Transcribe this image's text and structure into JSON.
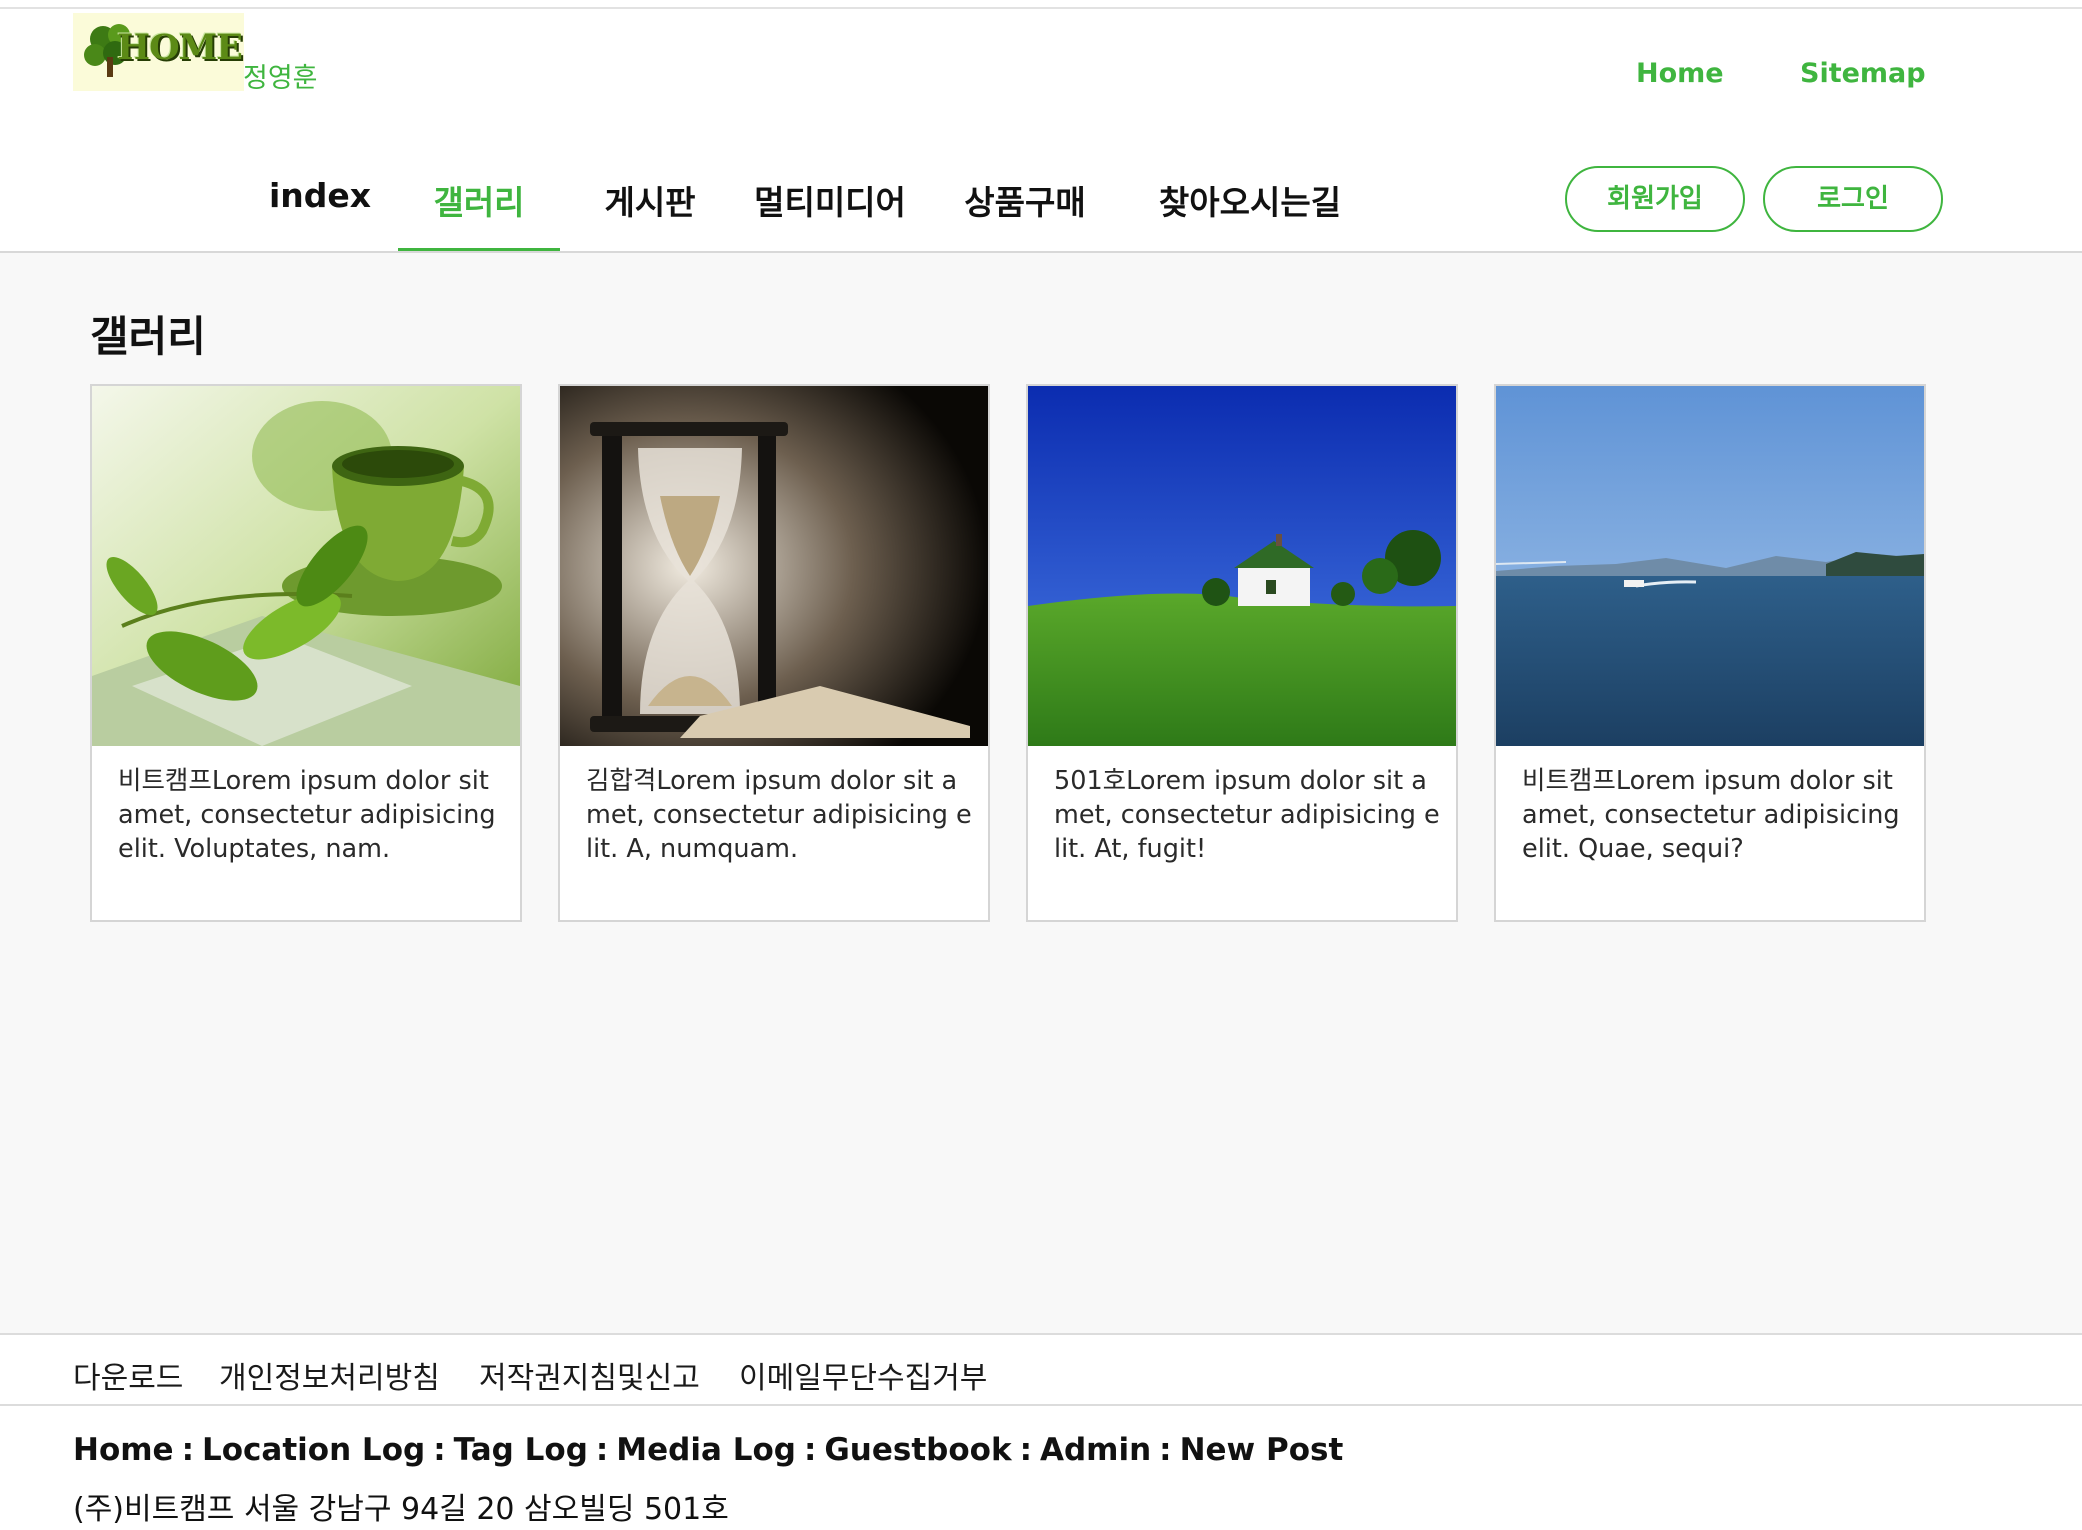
{
  "header": {
    "logo_text": "HOME",
    "owner_name": "정영훈",
    "top_links": [
      "Home",
      "Sitemap"
    ]
  },
  "nav": {
    "items": [
      "index",
      "갤러리",
      "게시판",
      "멀티미디어",
      "상품구매",
      "찾아오시는길"
    ],
    "active_index": 1,
    "signup_label": "회원가입",
    "login_label": "로그인"
  },
  "colors": {
    "accent": "#3fb53f",
    "main_bg": "#f8f8f8",
    "logo_bg": "#fbfbd9"
  },
  "gallery": {
    "title": "갤러리",
    "cards": [
      {
        "image": "green-teacup-with-leaves",
        "caption": "비트캠프Lorem ipsum dolor sit amet, consectetur adipisicing elit. Voluptates, nam."
      },
      {
        "image": "hourglass-with-sand",
        "caption": "김합격Lorem ipsum dolor sit amet, consectetur adipisicing elit. A, numquam."
      },
      {
        "image": "white-house-on-green-hill",
        "caption": "501호Lorem ipsum dolor sit amet, consectetur adipisicing elit. At, fugit!"
      },
      {
        "image": "sea-with-boat-and-bridge",
        "caption": "비트캠프Lorem ipsum dolor sit amet, consectetur adipisicing elit. Quae, sequi?"
      }
    ]
  },
  "footer": {
    "links": [
      "다운로드",
      "개인정보처리방침",
      "저작권지침및신고",
      "이메일무단수집거부"
    ],
    "blog_links": [
      "Home",
      "Location Log",
      "Tag Log",
      "Media Log",
      "Guestbook",
      "Admin",
      "New Post"
    ],
    "blog_separator": ":",
    "address": "(주)비트캠프 서울 강남구 94길 20 삼오빌딩 501호"
  }
}
